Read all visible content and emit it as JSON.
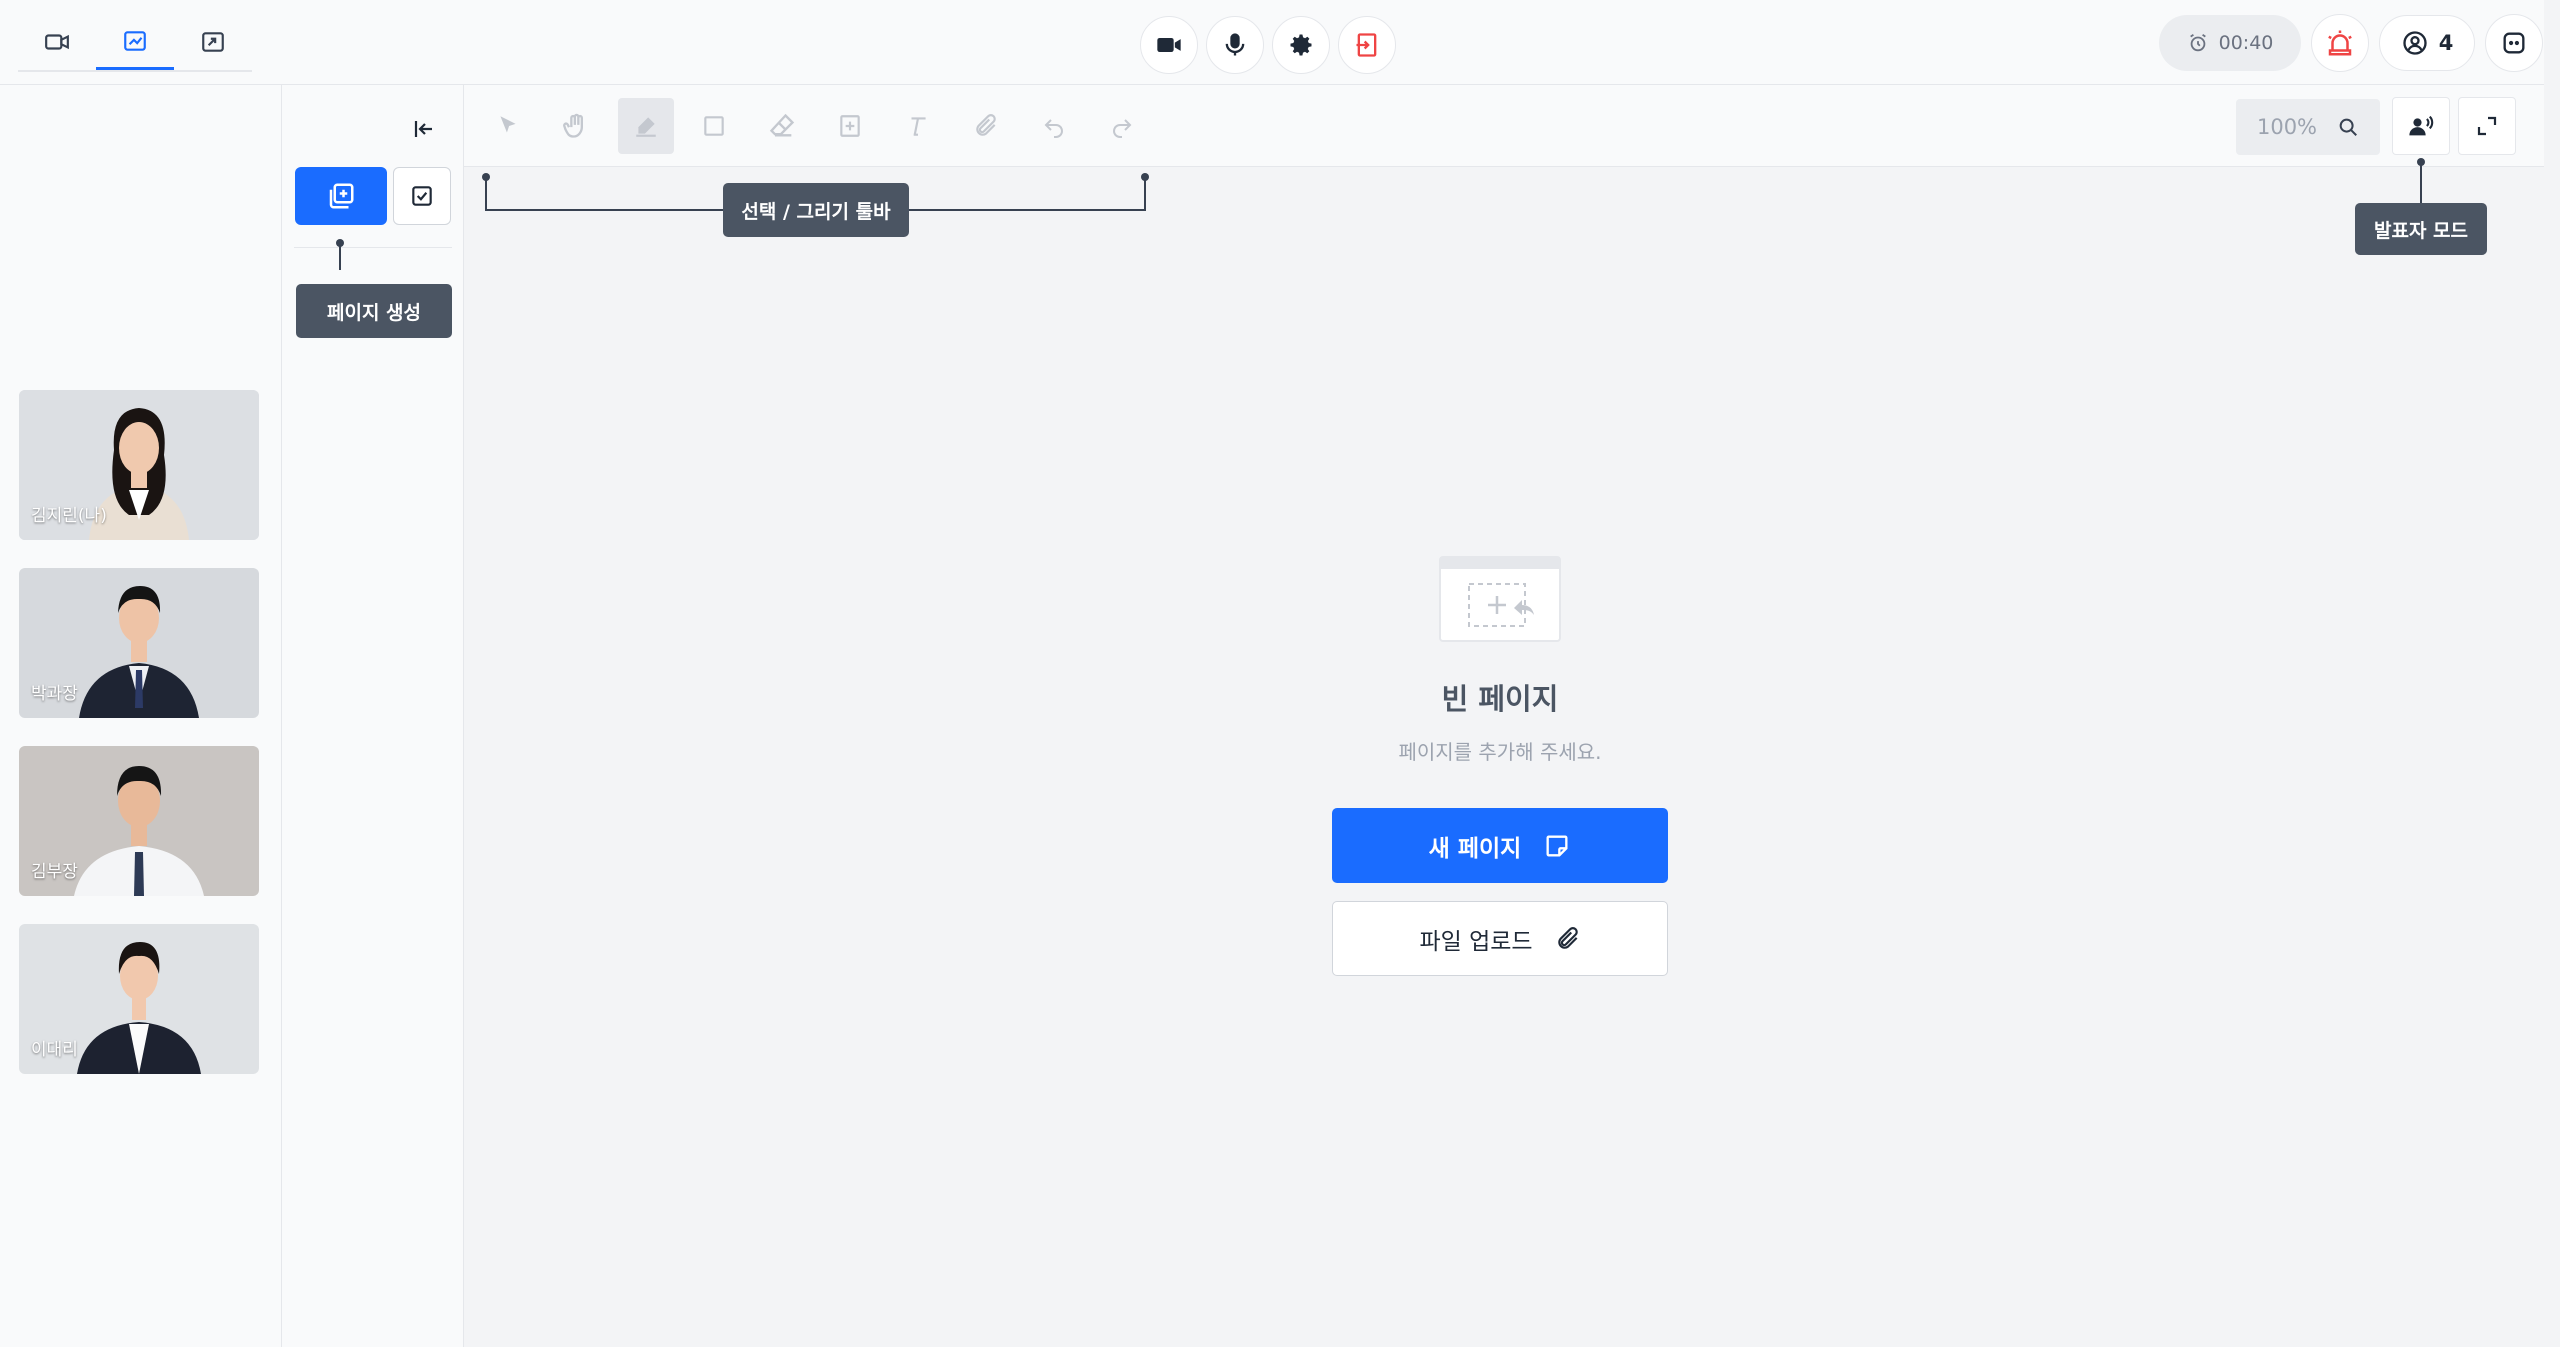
{
  "top_bar": {
    "view_tabs": [
      {
        "icon": "video-icon",
        "active": false
      },
      {
        "icon": "whiteboard-icon",
        "active": true
      },
      {
        "icon": "screen-share-icon",
        "active": false
      }
    ],
    "controls": [
      "camera-icon",
      "microphone-icon",
      "gear-icon",
      "exit-icon"
    ],
    "timer": "00:40",
    "participant_count": "4"
  },
  "participants": [
    {
      "name": "김지린(나)"
    },
    {
      "name": "박과장"
    },
    {
      "name": "김부장"
    },
    {
      "name": "이대리"
    }
  ],
  "page_panel": {
    "create_tooltip": "페이지 생성"
  },
  "toolbar": {
    "tools": [
      "select-arrow-icon",
      "hand-icon",
      "pen-icon",
      "rectangle-icon",
      "eraser-icon",
      "add-image-icon",
      "text-icon",
      "attach-icon",
      "undo-icon",
      "redo-icon"
    ],
    "active_tool": "pen-icon",
    "zoom": "100%",
    "toolbar_tooltip": "선택 / 그리기 툴바",
    "presenter_tooltip": "발표자 모드"
  },
  "empty_state": {
    "title": "빈 페이지",
    "subtitle": "페이지를 추가해 주세요.",
    "new_page_label": "새 페이지",
    "upload_label": "파일 업로드"
  },
  "colors": {
    "accent": "#1a6cff",
    "danger": "#ef4444",
    "tooltip_bg": "#4b5563"
  }
}
